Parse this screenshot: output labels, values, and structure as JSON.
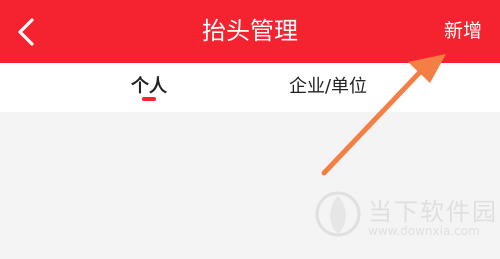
{
  "header": {
    "title": "抬头管理",
    "add_label": "新增"
  },
  "tabs": [
    {
      "label": "个人",
      "active": true
    },
    {
      "label": "企业/单位",
      "active": false
    }
  ],
  "watermark": {
    "name": "当下软件园",
    "url": "www.downxia.com"
  },
  "colors": {
    "accent": "#f5222f",
    "arrow": "#f47f45"
  },
  "icons": [
    "chevron-left-icon"
  ]
}
